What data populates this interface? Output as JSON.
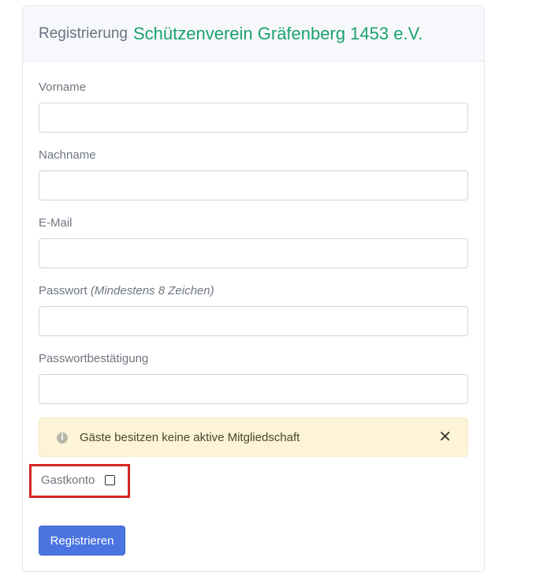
{
  "header": {
    "prefix": "Registrierung",
    "brand": "Schützenverein Gräfenberg 1453 e.V.",
    "brand_color": "#1aa36b"
  },
  "form": {
    "first_name": {
      "label": "Vorname",
      "value": ""
    },
    "last_name": {
      "label": "Nachname",
      "value": ""
    },
    "email": {
      "label": "E-Mail",
      "value": ""
    },
    "password": {
      "label": "Passwort",
      "hint": "(Mindestens 8 Zeichen)",
      "value": ""
    },
    "password_confirm": {
      "label": "Passwortbestätigung",
      "value": ""
    }
  },
  "alert": {
    "icon": "info-icon",
    "text": "Gäste besitzen keine aktive Mitgliedschaft",
    "close_glyph": "✕",
    "background": "#fdf3d6"
  },
  "guest": {
    "label": "Gastkonto",
    "checked": false,
    "highlight_color": "#d32626"
  },
  "submit": {
    "label": "Registrieren",
    "color": "#4a74e0"
  }
}
